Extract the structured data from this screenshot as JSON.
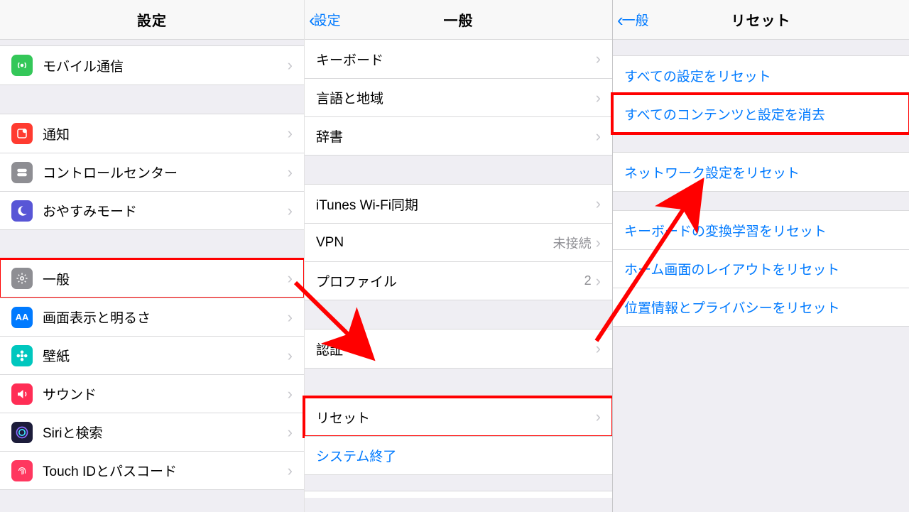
{
  "pane1": {
    "title": "設定",
    "items": {
      "mobile": "モバイル通信",
      "notify": "通知",
      "control": "コントロールセンター",
      "dnd": "おやすみモード",
      "general": "一般",
      "display": "画面表示と明るさ",
      "wall": "壁紙",
      "sound": "サウンド",
      "siri": "Siriと検索",
      "touchid": "Touch IDとパスコード"
    }
  },
  "pane2": {
    "back": "設定",
    "title": "一般",
    "items": {
      "keyboard": "キーボード",
      "lang": "言語と地域",
      "dict": "辞書",
      "itunes": "iTunes Wi-Fi同期",
      "vpn": "VPN",
      "vpn_val": "未接続",
      "profile": "プロファイル",
      "profile_val": "2",
      "auth": "認証",
      "reset": "リセット",
      "shutdown": "システム終了"
    }
  },
  "pane3": {
    "back": "一般",
    "title": "リセット",
    "items": {
      "reset_all": "すべての設定をリセット",
      "erase_all": "すべてのコンテンツと設定を消去",
      "reset_net": "ネットワーク設定をリセット",
      "reset_kbd": "キーボードの変換学習をリセット",
      "reset_home": "ホーム画面のレイアウトをリセット",
      "reset_priv": "位置情報とプライバシーをリセット"
    }
  }
}
